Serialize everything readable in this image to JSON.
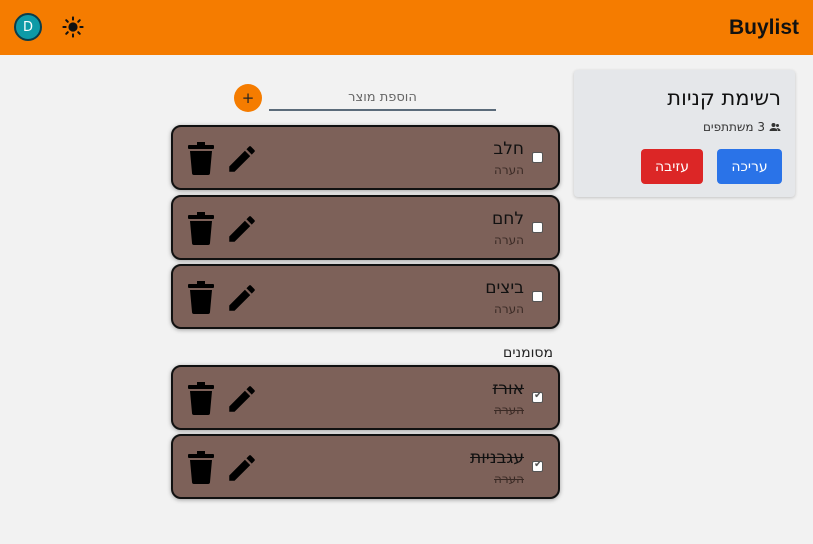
{
  "header": {
    "brand": "Buylist",
    "avatar_letter": "D",
    "theme_icon": "sun-icon",
    "accent_color": "#f57c00"
  },
  "list_card": {
    "title": "רשימת קניות",
    "participants": "3 משתתפים",
    "participants_icon": "people-icon",
    "edit_label": "עריכה",
    "leave_label": "עזיבה"
  },
  "add_product": {
    "button_label": "+",
    "placeholder": "הוספת מוצר"
  },
  "items": [
    {
      "name": "חלב",
      "note": "הערה",
      "checked": false
    },
    {
      "name": "לחם",
      "note": "הערה",
      "checked": false
    },
    {
      "name": "ביצים",
      "note": "הערה",
      "checked": false
    }
  ],
  "checked_section": {
    "label": "מסומנים",
    "items": [
      {
        "name": "אורז",
        "note": "הערה",
        "checked": true
      },
      {
        "name": "עגבניות",
        "note": "הערה",
        "checked": true
      }
    ]
  }
}
